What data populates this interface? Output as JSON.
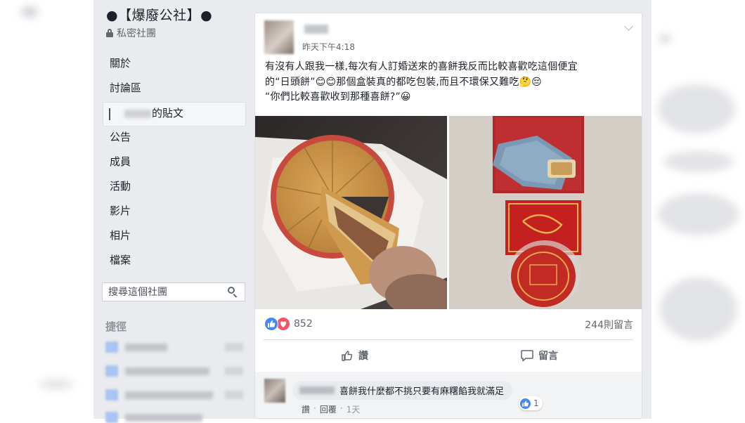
{
  "group": {
    "title": "●【爆廢公社】●",
    "privacy": "私密社團"
  },
  "sidebar": {
    "items": [
      {
        "label": "關於"
      },
      {
        "label": "討論區"
      },
      {
        "label": "的貼文"
      },
      {
        "label": "公告"
      },
      {
        "label": "成員"
      },
      {
        "label": "活動"
      },
      {
        "label": "影片"
      },
      {
        "label": "相片"
      },
      {
        "label": "檔案"
      }
    ],
    "search_placeholder": "搜尋這個社團",
    "shortcuts_title": "捷徑"
  },
  "post": {
    "timestamp": "昨天下午4:18",
    "lines": [
      "有沒有人跟我一樣,每次有人訂婚送來的喜餅我反而比較喜歡吃這個便宜",
      "的“日頭餅”😊😊那個盒裝真的都吃包裝,而且不環保又難吃🤔😔",
      "“你們比較喜歡收到那種喜餅?”😀"
    ],
    "reaction_count": "852",
    "comment_count": "244則留言",
    "like_label": "讚",
    "comment_label": "留言"
  },
  "comment": {
    "text": "喜餅我什麼都不挑只要有麻糬餡我就滿足",
    "reaction_count": "1",
    "like_label": "讚",
    "reply_label": "回覆",
    "time": "1天"
  },
  "colors": {
    "accent": "#4267b2",
    "like": "#4688f1",
    "love": "#f2546c",
    "background": "#e9ebee"
  },
  "icons": [
    "lock-icon",
    "search-icon",
    "chevron-down-icon",
    "like-reaction-icon",
    "love-reaction-icon",
    "thumbs-up-icon",
    "comment-icon"
  ]
}
